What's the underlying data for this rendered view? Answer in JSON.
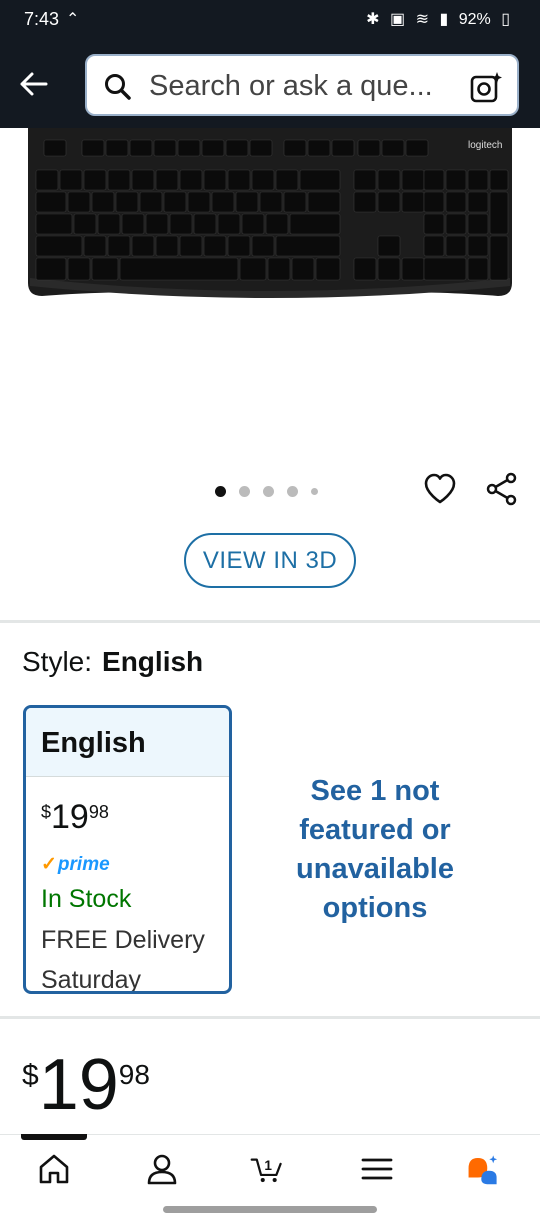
{
  "status_bar": {
    "time": "7:43",
    "battery": "92%"
  },
  "search": {
    "placeholder": "Search or ask a que..."
  },
  "product_image": {
    "brand_mark": "logitech"
  },
  "carousel": {
    "total": 5,
    "active_index": 0
  },
  "view3d": {
    "label": "VIEW IN 3D"
  },
  "style_selector": {
    "label": "Style:",
    "selected": "English",
    "options": [
      {
        "name": "English",
        "currency": "$",
        "price_whole": "19",
        "price_fraction": "98",
        "prime": "prime",
        "stock": "In Stock",
        "delivery": "FREE Delivery",
        "delivery_date": "Saturday"
      }
    ],
    "see_more": "See 1 not featured or unavailable options"
  },
  "price": {
    "currency": "$",
    "whole": "19",
    "fraction": "98"
  },
  "bottom_nav": {
    "items": [
      "home-icon",
      "account-icon",
      "cart-icon",
      "menu-icon",
      "rufus-icon"
    ],
    "cart_count": "1",
    "active": "home"
  },
  "colors": {
    "header_bg": "#131921",
    "link_blue": "#2262a0",
    "in_stock_green": "#007600",
    "prime_blue": "#1a98ff",
    "accent_orange": "#ff9900"
  }
}
